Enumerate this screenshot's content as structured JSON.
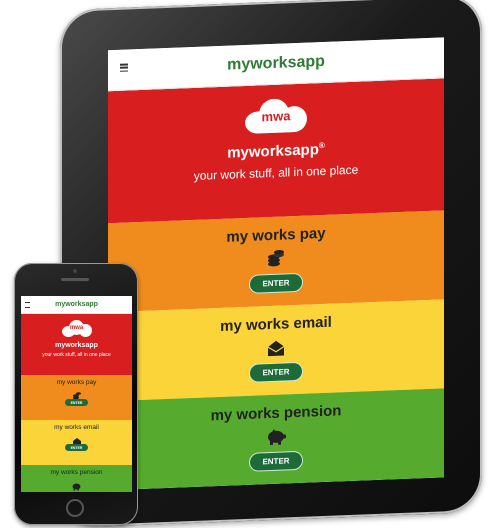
{
  "app": {
    "title": "myworksapp",
    "logo_text": "mwa",
    "hero_name": "myworksapp",
    "hero_mark": "®",
    "tagline": "your work stuff, all in one place"
  },
  "sections": [
    {
      "title": "my works pay",
      "button": "ENTER",
      "icon": "coins-icon",
      "color": "#ef8c1d"
    },
    {
      "title": "my works email",
      "button": "ENTER",
      "icon": "envelope-icon",
      "color": "#fbd439"
    },
    {
      "title": "my works pension",
      "button": "ENTER",
      "icon": "piggy-bank-icon",
      "color": "#56ab2f"
    }
  ],
  "colors": {
    "hero": "#d81e1e",
    "brand_green": "#2f7d32",
    "button": "#1e6b3a"
  }
}
